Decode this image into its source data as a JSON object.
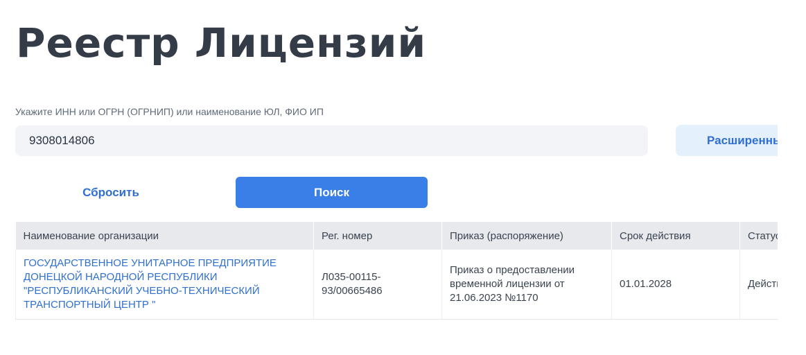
{
  "page": {
    "title": "Реестр Лицензий"
  },
  "search": {
    "label": "Укажите ИНН или ОГРН (ОГРНИП) или наименование ЮЛ, ФИО ИП",
    "value": "9308014806",
    "advanced_label": "Расширенный поиск",
    "reset_label": "Сбросить",
    "submit_label": "Поиск"
  },
  "table": {
    "headers": [
      "Наименование организации",
      "Рег. номер",
      "Приказ (распоряжение)",
      "Срок действия",
      "Статус"
    ],
    "rows": [
      {
        "organization": "ГОСУДАРСТВЕННОЕ УНИТАРНОЕ ПРЕДПРИЯТИЕ ДОНЕЦКОЙ НАРОДНОЙ РЕСПУБЛИКИ \"РЕСПУБЛИКАНСКИЙ УЧЕБНО-ТЕХНИЧЕСКИЙ ТРАНСПОРТНЫЙ ЦЕНТР \"",
        "reg_number": "Л035-00115-93/00665486",
        "order": "Приказ о предоставлении временной лицензии от 21.06.2023 №1170",
        "validity": "01.01.2028",
        "status": "Действует"
      }
    ]
  },
  "colors": {
    "accent": "#3a7ee8",
    "link": "#2f6fd1",
    "input_bg": "#f2f4f7",
    "header_bg": "#e7e9ed",
    "advanced_bg": "#e5f0fd"
  }
}
